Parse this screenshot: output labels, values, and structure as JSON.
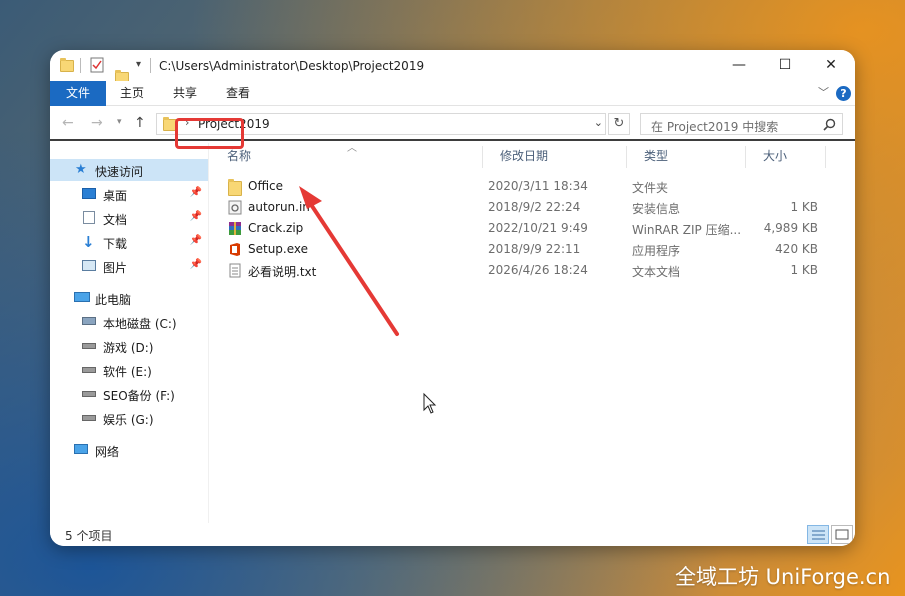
{
  "window": {
    "title_path": "C:\\Users\\Administrator\\Desktop\\Project2019",
    "controls": {
      "minimize": "—",
      "maximize": "☐",
      "close": "✕"
    }
  },
  "ribbon": {
    "tabs": [
      {
        "label": "文件",
        "active": true
      },
      {
        "label": "主页"
      },
      {
        "label": "共享"
      },
      {
        "label": "查看"
      }
    ],
    "help": "?"
  },
  "address": {
    "path": "Project2019",
    "search_placeholder": "在 Project2019 中搜索"
  },
  "nav": {
    "quick_access": "快速访问",
    "pinned": [
      "桌面",
      "文档",
      "下载",
      "图片"
    ],
    "this_pc": "此电脑",
    "drives": [
      "本地磁盘 (C:)",
      "游戏 (D:)",
      "软件 (E:)",
      "SEO备份 (F:)",
      "娱乐 (G:)"
    ],
    "network": "网络"
  },
  "list": {
    "columns": [
      "名称",
      "修改日期",
      "类型",
      "大小"
    ],
    "rows": [
      {
        "name": "Office",
        "date": "2020/3/11 18:34",
        "type": "文件夹",
        "size": "",
        "icon": "folder-icon"
      },
      {
        "name": "autorun.in",
        "date": "2018/9/2 22:24",
        "type": "安装信息",
        "size": "1 KB",
        "icon": "settings-file-icon"
      },
      {
        "name": "Crack.zip",
        "date": "2022/10/21 9:49",
        "type": "WinRAR ZIP 压缩...",
        "size": "4,989 KB",
        "icon": "winrar-icon"
      },
      {
        "name": "Setup.exe",
        "date": "2018/9/9 22:11",
        "type": "应用程序",
        "size": "420 KB",
        "icon": "office-icon"
      },
      {
        "name": "必看说明.txt",
        "date": "2026/4/26 18:24",
        "type": "文本文档",
        "size": "1 KB",
        "icon": "text-file-icon"
      }
    ]
  },
  "status": {
    "count": "5 个项目"
  },
  "watermark": "全域工坊 UniForge.cn",
  "colors": {
    "accent": "#1b6ac2",
    "highlight": "#e53935",
    "selected_bg": "#cce4f7"
  }
}
